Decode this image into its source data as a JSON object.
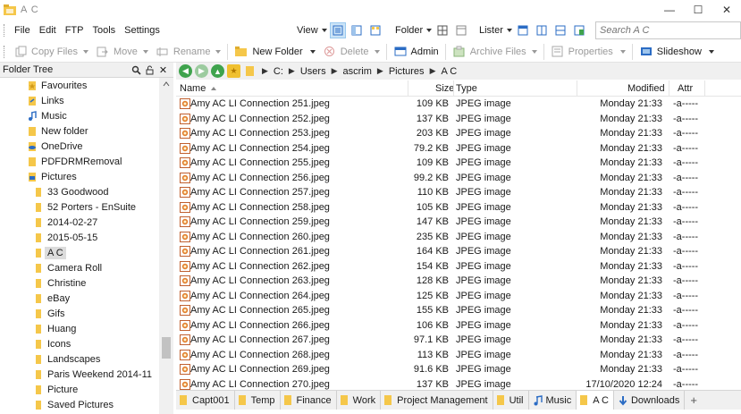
{
  "window": {
    "title": "A C",
    "minimize": "—",
    "maximize": "☐",
    "close": "✕"
  },
  "menu": [
    "File",
    "Edit",
    "FTP",
    "Tools",
    "Settings"
  ],
  "view_toolbar": {
    "view_label": "View",
    "folder_label": "Folder",
    "lister_label": "Lister"
  },
  "search": {
    "placeholder": "Search A C"
  },
  "commands": {
    "copy_files": "Copy Files",
    "move": "Move",
    "rename": "Rename",
    "new_folder": "New Folder",
    "delete": "Delete",
    "admin": "Admin",
    "archive_files": "Archive Files",
    "properties": "Properties",
    "slideshow": "Slideshow"
  },
  "tree": {
    "header": "Folder Tree",
    "items": [
      {
        "label": "Favourites",
        "icon": "star-folder-icon"
      },
      {
        "label": "Links",
        "icon": "links-folder-icon"
      },
      {
        "label": "Music",
        "icon": "music-folder-icon"
      },
      {
        "label": "New folder",
        "icon": "folder-icon"
      },
      {
        "label": "OneDrive",
        "icon": "cloud-folder-icon"
      },
      {
        "label": "PDFDRMRemoval",
        "icon": "folder-icon"
      },
      {
        "label": "Pictures",
        "icon": "pictures-folder-icon"
      },
      {
        "label": "33 Goodwood",
        "icon": "folder-icon"
      },
      {
        "label": "52 Porters - EnSuite",
        "icon": "folder-icon"
      },
      {
        "label": "2014-02-27",
        "icon": "folder-icon"
      },
      {
        "label": "2015-05-15",
        "icon": "folder-icon"
      },
      {
        "label": "A C",
        "icon": "folder-icon",
        "selected": true
      },
      {
        "label": "Camera Roll",
        "icon": "folder-icon"
      },
      {
        "label": "Christine",
        "icon": "folder-icon"
      },
      {
        "label": "eBay",
        "icon": "folder-icon"
      },
      {
        "label": "Gifs",
        "icon": "folder-icon"
      },
      {
        "label": "Huang",
        "icon": "folder-icon"
      },
      {
        "label": "Icons",
        "icon": "folder-icon"
      },
      {
        "label": "Landscapes",
        "icon": "folder-icon"
      },
      {
        "label": "Paris Weekend 2014-11",
        "icon": "folder-icon"
      },
      {
        "label": "Picture",
        "icon": "folder-icon"
      },
      {
        "label": "Saved Pictures",
        "icon": "folder-icon"
      }
    ]
  },
  "breadcrumb": [
    "C:",
    "Users",
    "ascrim",
    "Pictures",
    "A C"
  ],
  "columns": {
    "name": "Name",
    "size": "Size",
    "type": "Type",
    "modified": "Modified",
    "attr": "Attr"
  },
  "files": [
    {
      "name": "Amy AC LI Connection 251.jpeg",
      "size": "109 KB",
      "type": "JPEG image",
      "modified": "Monday  21:33",
      "attr": "-a-----"
    },
    {
      "name": "Amy AC LI Connection 252.jpeg",
      "size": "137 KB",
      "type": "JPEG image",
      "modified": "Monday  21:33",
      "attr": "-a-----"
    },
    {
      "name": "Amy AC LI Connection 253.jpeg",
      "size": "203 KB",
      "type": "JPEG image",
      "modified": "Monday  21:33",
      "attr": "-a-----"
    },
    {
      "name": "Amy AC LI Connection 254.jpeg",
      "size": "79.2 KB",
      "type": "JPEG image",
      "modified": "Monday  21:33",
      "attr": "-a-----"
    },
    {
      "name": "Amy AC LI Connection 255.jpeg",
      "size": "109 KB",
      "type": "JPEG image",
      "modified": "Monday  21:33",
      "attr": "-a-----"
    },
    {
      "name": "Amy AC LI Connection 256.jpeg",
      "size": "99.2 KB",
      "type": "JPEG image",
      "modified": "Monday  21:33",
      "attr": "-a-----"
    },
    {
      "name": "Amy AC LI Connection 257.jpeg",
      "size": "110 KB",
      "type": "JPEG image",
      "modified": "Monday  21:33",
      "attr": "-a-----"
    },
    {
      "name": "Amy AC LI Connection 258.jpeg",
      "size": "105 KB",
      "type": "JPEG image",
      "modified": "Monday  21:33",
      "attr": "-a-----"
    },
    {
      "name": "Amy AC LI Connection 259.jpeg",
      "size": "147 KB",
      "type": "JPEG image",
      "modified": "Monday  21:33",
      "attr": "-a-----"
    },
    {
      "name": "Amy AC LI Connection 260.jpeg",
      "size": "235 KB",
      "type": "JPEG image",
      "modified": "Monday  21:33",
      "attr": "-a-----"
    },
    {
      "name": "Amy AC LI Connection 261.jpeg",
      "size": "164 KB",
      "type": "JPEG image",
      "modified": "Monday  21:33",
      "attr": "-a-----"
    },
    {
      "name": "Amy AC LI Connection 262.jpeg",
      "size": "154 KB",
      "type": "JPEG image",
      "modified": "Monday  21:33",
      "attr": "-a-----"
    },
    {
      "name": "Amy AC LI Connection 263.jpeg",
      "size": "128 KB",
      "type": "JPEG image",
      "modified": "Monday  21:33",
      "attr": "-a-----"
    },
    {
      "name": "Amy AC LI Connection 264.jpeg",
      "size": "125 KB",
      "type": "JPEG image",
      "modified": "Monday  21:33",
      "attr": "-a-----"
    },
    {
      "name": "Amy AC LI Connection 265.jpeg",
      "size": "155 KB",
      "type": "JPEG image",
      "modified": "Monday  21:33",
      "attr": "-a-----"
    },
    {
      "name": "Amy AC LI Connection 266.jpeg",
      "size": "106 KB",
      "type": "JPEG image",
      "modified": "Monday  21:33",
      "attr": "-a-----"
    },
    {
      "name": "Amy AC LI Connection 267.jpeg",
      "size": "97.1 KB",
      "type": "JPEG image",
      "modified": "Monday  21:33",
      "attr": "-a-----"
    },
    {
      "name": "Amy AC LI Connection 268.jpeg",
      "size": "113 KB",
      "type": "JPEG image",
      "modified": "Monday  21:33",
      "attr": "-a-----"
    },
    {
      "name": "Amy AC LI Connection 269.jpeg",
      "size": "91.6 KB",
      "type": "JPEG image",
      "modified": "Monday  21:33",
      "attr": "-a-----"
    },
    {
      "name": "Amy AC LI Connection 270.jpeg",
      "size": "137 KB",
      "type": "JPEG image",
      "modified": "17/10/2020  12:24",
      "attr": "-a-----"
    }
  ],
  "tabs": [
    {
      "label": "Capt001",
      "icon": "folder-icon"
    },
    {
      "label": "Temp",
      "icon": "folder-icon"
    },
    {
      "label": "Finance",
      "icon": "folder-icon"
    },
    {
      "label": "Work",
      "icon": "folder-icon"
    },
    {
      "label": "Project Management",
      "icon": "folder-icon"
    },
    {
      "label": "Util",
      "icon": "folder-icon"
    },
    {
      "label": "Music",
      "icon": "music-icon"
    },
    {
      "label": "A C",
      "icon": "folder-icon",
      "active": true
    },
    {
      "label": "Downloads",
      "icon": "download-icon"
    }
  ],
  "tab_add": "+",
  "colors": {
    "folder": "#f5c74a",
    "selection": "#cce4f7",
    "nav_green": "#3fa34d",
    "accent_blue": "#2b6cc4"
  }
}
